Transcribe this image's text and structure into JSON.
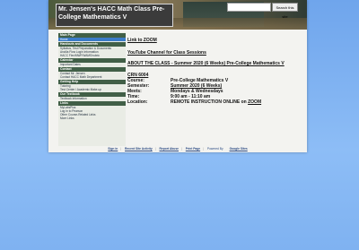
{
  "header": {
    "site_title": "Mr. Jensen's HACC Math Class Pre-College Mathematics V",
    "search_placeholder": "",
    "search_button": "Search this site"
  },
  "sidebar": {
    "sections": [
      {
        "heading": "Main Page",
        "items": [
          {
            "label": "Home",
            "active": true
          }
        ]
      },
      {
        "heading": "Handouts and Documents",
        "items": [
          {
            "label": "Syllabus, Test Preparation & Documents"
          },
          {
            "label": "Ancilla Flow Login Information"
          },
          {
            "label": "HACC Flex/MWF/WAMS/rubric"
          }
        ]
      },
      {
        "heading": "Calendar",
        "items": [
          {
            "label": "Important Dates"
          }
        ]
      },
      {
        "heading": "Contact",
        "items": [
          {
            "label": "Contact Mr. Jensen"
          },
          {
            "label": "Contact HACC Math Department"
          }
        ]
      },
      {
        "heading": "Getting Help",
        "items": [
          {
            "label": "Tutoring"
          },
          {
            "label": "Test Center / Academic Make-up"
          }
        ]
      },
      {
        "heading": "Our Textbook",
        "items": [
          {
            "label": "Textbook Information"
          }
        ]
      },
      {
        "heading": "Links",
        "items": [
          {
            "label": "MyLabsPlus"
          },
          {
            "label": "Log In to Pearson"
          },
          {
            "label": "Other Course-Related Links"
          },
          {
            "label": "More Links"
          }
        ]
      }
    ]
  },
  "main": {
    "zoom_link": "Link to ZOOM",
    "youtube_link": "YouTube Channel for Class Sessions",
    "about_link": "ABOUT THE CLASS - Summer 2020 (6 Weeks) Pre-College Mathematics V",
    "crn": "CRN 6004",
    "course_label": "Course:",
    "course_value": "Pre-College Mathematics V",
    "semester_label": "Semester:",
    "semester_value": "Summer 2020 (6 Weeks)",
    "meets_label": "Meets:",
    "meets_value": "Mondays & Wednesdays",
    "time_label": "Time:",
    "time_value": "9:00 am - 11:10 am",
    "location_label": "Location:",
    "location_value": "REMOTE INSTRUCTION ONLINE on ",
    "location_zoom": "ZOOM"
  },
  "footer": {
    "links": [
      "Sign in",
      "Recent Site Activity",
      "Report Abuse",
      "Print Page",
      "Powered By",
      "Google Sites"
    ]
  }
}
